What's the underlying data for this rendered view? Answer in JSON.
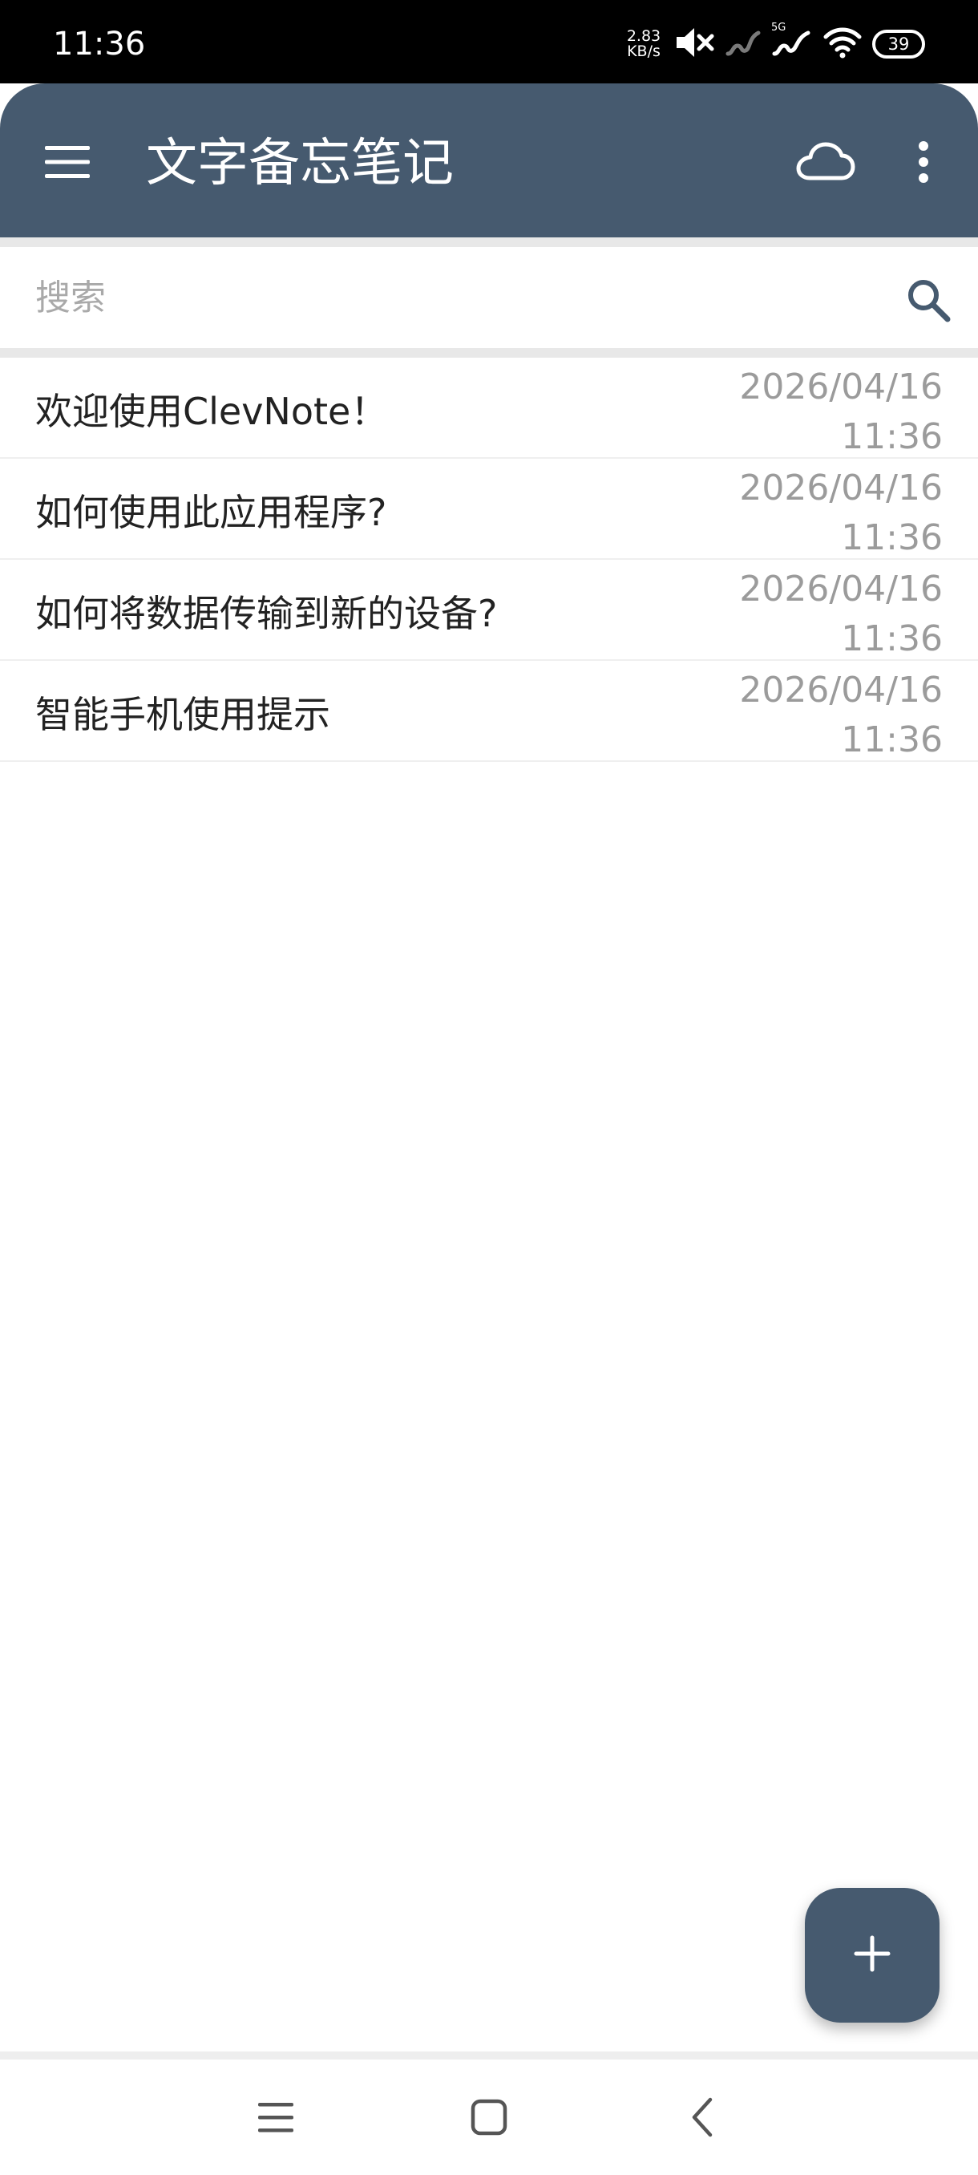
{
  "status_bar": {
    "time": "11:36",
    "net_speed_value": "2.83",
    "net_speed_unit": "KB/s",
    "network_label": "5G",
    "battery": "39",
    "icons": [
      "mute-icon",
      "signal-icon",
      "signal-5g-icon",
      "wifi-icon",
      "battery-icon"
    ]
  },
  "app_bar": {
    "title": "文字备忘笔记",
    "icons": [
      "hamburger-menu-icon",
      "cloud-icon",
      "more-vert-icon"
    ],
    "background_color": "#465a6f"
  },
  "search": {
    "placeholder": "搜索",
    "value": "",
    "icon": "search-icon",
    "icon_color": "#465a6f"
  },
  "notes": [
    {
      "title": "欢迎使用ClevNote！",
      "date": "2026/04/16",
      "time": "11:36"
    },
    {
      "title": "如何使用此应用程序?",
      "date": "2026/04/16",
      "time": "11:36"
    },
    {
      "title": "如何将数据传输到新的设备?",
      "date": "2026/04/16",
      "time": "11:36"
    },
    {
      "title": "智能手机使用提示",
      "date": "2026/04/16",
      "time": "11:36"
    }
  ],
  "fab": {
    "icon": "plus-icon",
    "color": "#465a6f"
  },
  "nav_bar": {
    "icons": [
      "recents-icon",
      "home-icon",
      "back-icon"
    ]
  }
}
